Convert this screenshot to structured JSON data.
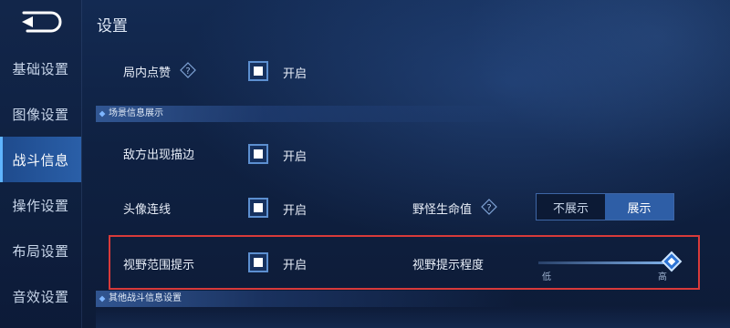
{
  "header": {
    "title": "设置"
  },
  "sidebar": {
    "items": [
      {
        "label": "基础设置"
      },
      {
        "label": "图像设置"
      },
      {
        "label": "战斗信息"
      },
      {
        "label": "操作设置"
      },
      {
        "label": "布局设置"
      },
      {
        "label": "音效设置"
      }
    ],
    "active_index": 2
  },
  "settings": {
    "like_in_game": {
      "label": "局内点赞",
      "checked": true,
      "check_text": "开启"
    },
    "section_scene": {
      "title": "场景信息展示"
    },
    "enemy_outline": {
      "label": "敌方出现描边",
      "checked": true,
      "check_text": "开启"
    },
    "avatar_line": {
      "label": "头像连线",
      "checked": true,
      "check_text": "开启"
    },
    "monster_hp": {
      "label": "野怪生命值",
      "options": [
        "不展示",
        "展示"
      ],
      "selected": "展示"
    },
    "vision_hint": {
      "label": "视野范围提示",
      "checked": true,
      "check_text": "开启"
    },
    "vision_level": {
      "label": "视野提示程度",
      "min_label": "低",
      "max_label": "高",
      "value": 1.0
    },
    "section_other": {
      "title": "其他战斗信息设置"
    }
  },
  "colors": {
    "accent": "#2e5ea6",
    "highlight_border": "#d83a3a",
    "background": "#0f1f3f"
  }
}
